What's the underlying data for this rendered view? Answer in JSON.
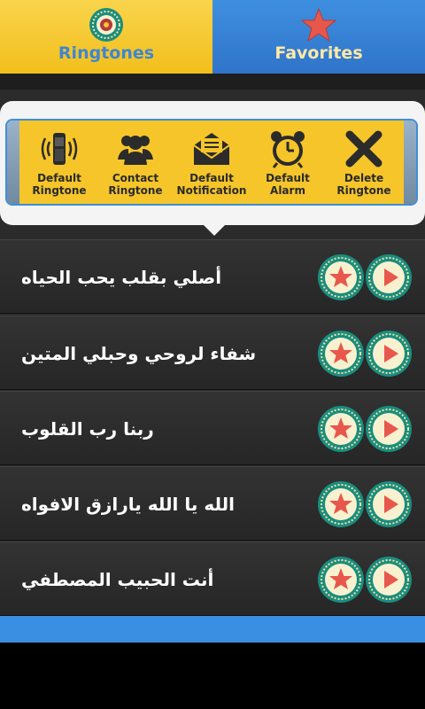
{
  "tabs": [
    {
      "label": "Ringtones",
      "icon": "medallion-icon",
      "active": true
    },
    {
      "label": "Favorites",
      "icon": "star-icon",
      "active": false
    }
  ],
  "toolbar": [
    {
      "line1": "Default",
      "line2": "Ringtone",
      "icon": "phone-ringing-icon"
    },
    {
      "line1": "Contact",
      "line2": "Ringtone",
      "icon": "contacts-icon"
    },
    {
      "line1": "Default",
      "line2": "Notification",
      "icon": "envelope-icon"
    },
    {
      "line1": "Default",
      "line2": "Alarm",
      "icon": "alarm-clock-icon"
    },
    {
      "line1": "Delete",
      "line2": "Ringtone",
      "icon": "close-x-icon"
    }
  ],
  "ringtones": [
    {
      "title": "أصلي بقلب يحب الحياه"
    },
    {
      "title": "شفاء لروحي وحبلي المتين"
    },
    {
      "title": "ربنا رب القلوب"
    },
    {
      "title": "الله يا الله يارازق الافواه"
    },
    {
      "title": "أنت الحبيب المصطفي"
    }
  ],
  "colors": {
    "tab_active": "#f5c52a",
    "tab_inactive": "#2f74c9",
    "accent_star": "#e8574b",
    "medallion_ring": "#1a8d7f"
  }
}
